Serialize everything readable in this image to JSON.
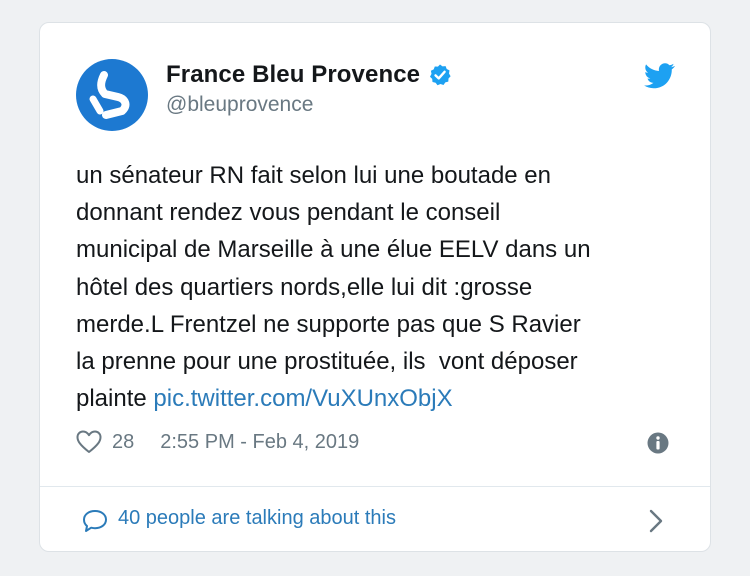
{
  "author": {
    "display_name": "France Bleu Provence",
    "handle": "@bleuprovence",
    "verified": true
  },
  "tweet": {
    "text": "un sénateur RN fait selon lui une boutade en\ndonnant rendez vous pendant le conseil\nmunicipal de Marseille à une élue EELV dans un\nhôtel des quartiers nords,elle lui dit :grosse\nmerde.L Frentzel ne supporte pas que S Ravier\nla prenne pour une prostituée, ils  vont déposer\nplainte ",
    "link": "pic.twitter.com/VuXUnxObjX",
    "likes": "28",
    "timestamp": "2:55 PM - Feb 4, 2019"
  },
  "footer": {
    "talking_label": "40 people are talking about this"
  },
  "icons": {
    "heart": "heart-icon",
    "info": "info-icon",
    "bubble": "speech-bubble-icon",
    "chevron": "chevron-right-icon",
    "bird": "twitter-bird-icon",
    "verified": "verified-badge-icon"
  },
  "colors": {
    "avatar_bg": "#1d79d1",
    "verified": "#1da1f2",
    "twitter_blue": "#1da1f2",
    "link": "#2b7bb9",
    "text": "#14171a",
    "muted": "#697882",
    "page_bg": "#eff1f3"
  }
}
